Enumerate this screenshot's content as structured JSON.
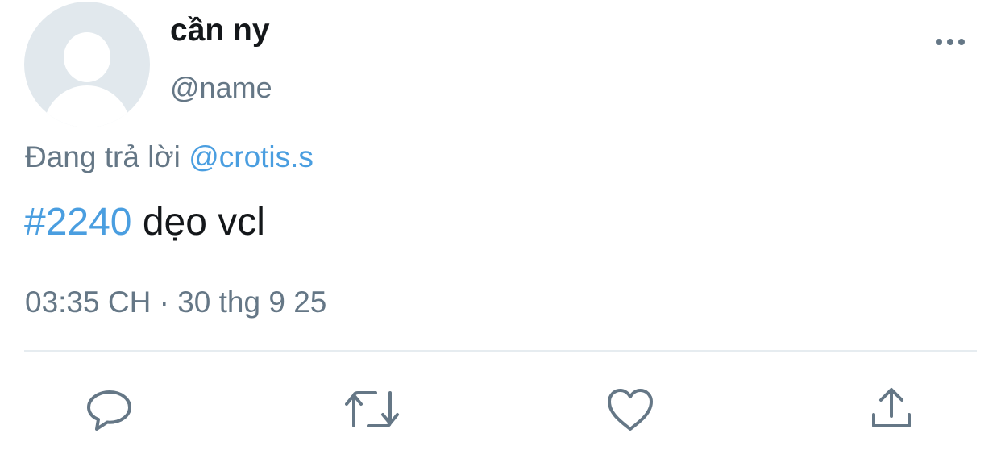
{
  "tweet": {
    "author": {
      "display_name": "cần ny",
      "handle": "@name",
      "avatar_icon": "default-profile-icon"
    },
    "reply_prefix": "Đang trả lời",
    "reply_to": "@crotis.s",
    "hashtag": "#2240",
    "text": " dẹo vcl",
    "timestamp": "03:35 CH · 30 thg 9 25"
  },
  "actions": {
    "reply_icon": "comment-icon",
    "retweet_icon": "retweet-icon",
    "like_icon": "heart-icon",
    "share_icon": "share-icon",
    "more_icon": "more-options-icon"
  },
  "colors": {
    "link": "#4a9ee0",
    "text": "#14171a",
    "secondary": "#657786",
    "icon": "#657786",
    "divider": "#e6ecf0",
    "avatar_bg": "#e1e8ed"
  }
}
